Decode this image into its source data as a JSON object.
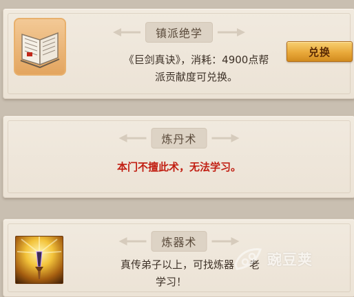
{
  "cards": [
    {
      "title": "镇派绝学",
      "line1": "《巨剑真诀》，消耗：4900点帮",
      "line2": "派贡献度可兑换。",
      "button_label": "兑换",
      "icon": "book-icon"
    },
    {
      "title": "炼丹术",
      "line1": "本门不擅此术，无法学习。"
    },
    {
      "title": "炼器术",
      "line1": "真传弟子以上，可找炼器",
      "line1_tail": "老",
      "line2": "学习！",
      "icon": "sword-icon"
    }
  ],
  "watermark": {
    "text": "豌豆荚",
    "icon": "pea-pod-logo-icon"
  },
  "colors": {
    "accent_red": "#c11e12",
    "button_gold": "#e9a93a"
  }
}
